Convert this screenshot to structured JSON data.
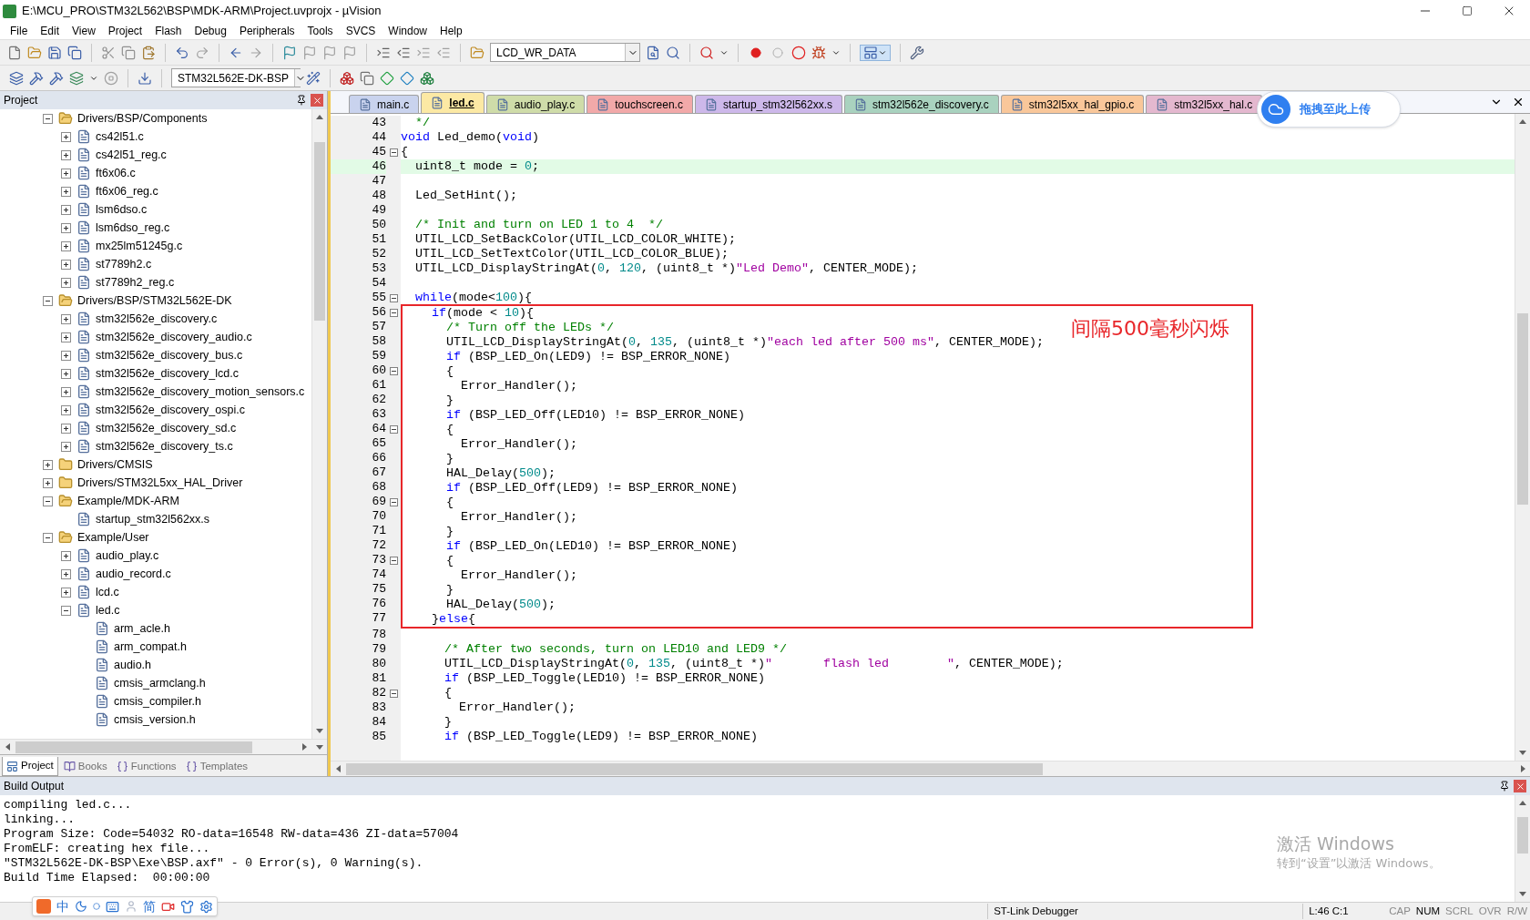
{
  "window": {
    "title": "E:\\MCU_PRO\\STM32L562\\BSP\\MDK-ARM\\Project.uvprojx - µVision"
  },
  "menu": [
    "File",
    "Edit",
    "View",
    "Project",
    "Flash",
    "Debug",
    "Peripherals",
    "Tools",
    "SVCS",
    "Window",
    "Help"
  ],
  "toolbar": {
    "find_combo": "LCD_WR_DATA",
    "target_combo": "STM32L562E-DK-BSP"
  },
  "project_panel": {
    "title": "Project",
    "tree": [
      {
        "label": "Drivers/BSP/Components",
        "kind": "folder",
        "expanded": true,
        "children": [
          {
            "label": "cs42l51.c",
            "kind": "source",
            "expanded": false
          },
          {
            "label": "cs42l51_reg.c",
            "kind": "source",
            "expanded": false
          },
          {
            "label": "ft6x06.c",
            "kind": "source",
            "expanded": false
          },
          {
            "label": "ft6x06_reg.c",
            "kind": "source",
            "expanded": false
          },
          {
            "label": "lsm6dso.c",
            "kind": "source",
            "expanded": false
          },
          {
            "label": "lsm6dso_reg.c",
            "kind": "source",
            "expanded": false
          },
          {
            "label": "mx25lm51245g.c",
            "kind": "source",
            "expanded": false
          },
          {
            "label": "st7789h2.c",
            "kind": "source",
            "expanded": false
          },
          {
            "label": "st7789h2_reg.c",
            "kind": "source",
            "expanded": false
          }
        ]
      },
      {
        "label": "Drivers/BSP/STM32L562E-DK",
        "kind": "folder",
        "expanded": true,
        "children": [
          {
            "label": "stm32l562e_discovery.c",
            "kind": "source",
            "expanded": false
          },
          {
            "label": "stm32l562e_discovery_audio.c",
            "kind": "source",
            "expanded": false
          },
          {
            "label": "stm32l562e_discovery_bus.c",
            "kind": "source",
            "expanded": false
          },
          {
            "label": "stm32l562e_discovery_lcd.c",
            "kind": "source",
            "expanded": false
          },
          {
            "label": "stm32l562e_discovery_motion_sensors.c",
            "kind": "source",
            "expanded": false
          },
          {
            "label": "stm32l562e_discovery_ospi.c",
            "kind": "source",
            "expanded": false
          },
          {
            "label": "stm32l562e_discovery_sd.c",
            "kind": "source",
            "expanded": false
          },
          {
            "label": "stm32l562e_discovery_ts.c",
            "kind": "source",
            "expanded": false
          }
        ]
      },
      {
        "label": "Drivers/CMSIS",
        "kind": "folder",
        "expanded": false
      },
      {
        "label": "Drivers/STM32L5xx_HAL_Driver",
        "kind": "folder",
        "expanded": false
      },
      {
        "label": "Example/MDK-ARM",
        "kind": "folder",
        "expanded": true,
        "children": [
          {
            "label": "startup_stm32l562xx.s",
            "kind": "file"
          }
        ]
      },
      {
        "label": "Example/User",
        "kind": "folder",
        "expanded": true,
        "children": [
          {
            "label": "audio_play.c",
            "kind": "source",
            "expanded": false
          },
          {
            "label": "audio_record.c",
            "kind": "source",
            "expanded": false
          },
          {
            "label": "lcd.c",
            "kind": "source",
            "expanded": false
          },
          {
            "label": "led.c",
            "kind": "source",
            "expanded": true,
            "children": [
              {
                "label": "arm_acle.h",
                "kind": "file"
              },
              {
                "label": "arm_compat.h",
                "kind": "file"
              },
              {
                "label": "audio.h",
                "kind": "file"
              },
              {
                "label": "cmsis_armclang.h",
                "kind": "file"
              },
              {
                "label": "cmsis_compiler.h",
                "kind": "file"
              },
              {
                "label": "cmsis_version.h",
                "kind": "file"
              }
            ]
          }
        ]
      }
    ],
    "tabs": [
      {
        "label": "Project",
        "selected": true
      },
      {
        "label": "Books",
        "selected": false
      },
      {
        "label": "Functions",
        "selected": false
      },
      {
        "label": "Templates",
        "selected": false
      }
    ]
  },
  "editor": {
    "tabs": [
      {
        "label": "main.c",
        "selected": false,
        "color": "#c9d3ee"
      },
      {
        "label": "led.c",
        "selected": true,
        "color": "#fce9a4"
      },
      {
        "label": "audio_play.c",
        "selected": false,
        "color": "#cfdca9"
      },
      {
        "label": "touchscreen.c",
        "selected": false,
        "color": "#f2a9a9"
      },
      {
        "label": "startup_stm32l562xx.s",
        "selected": false,
        "color": "#cdb8ea"
      },
      {
        "label": "stm32l562e_discovery.c",
        "selected": false,
        "color": "#a9d2bf"
      },
      {
        "label": "stm32l5xx_hal_gpio.c",
        "selected": false,
        "color": "#f9c79a"
      },
      {
        "label": "stm32l5xx_hal.c",
        "selected": false,
        "color": "#e4b8cf"
      }
    ],
    "blocks": [
      {
        "kind": "plain",
        "lines": [
          {
            "number": "43",
            "fold": false,
            "current": false,
            "tokens": [
              {
                "kind": "comment",
                "text": "  */"
              }
            ]
          },
          {
            "number": "44",
            "fold": false,
            "current": false,
            "tokens": [
              {
                "kind": "keyword",
                "text": "void"
              },
              {
                "kind": "plain",
                "text": " Led_demo("
              },
              {
                "kind": "keyword",
                "text": "void"
              },
              {
                "kind": "plain",
                "text": ")"
              }
            ]
          },
          {
            "number": "45",
            "fold": true,
            "current": false,
            "tokens": [
              {
                "kind": "plain",
                "text": "{"
              }
            ]
          },
          {
            "number": "46",
            "fold": false,
            "current": true,
            "tokens": [
              {
                "kind": "plain",
                "text": "  uint8_t mode = "
              },
              {
                "kind": "number",
                "text": "0"
              },
              {
                "kind": "plain",
                "text": ";"
              }
            ]
          },
          {
            "number": "47",
            "fold": false,
            "current": false
          },
          {
            "number": "48",
            "fold": false,
            "current": false,
            "tokens": [
              {
                "kind": "plain",
                "text": "  Led_SetHint();"
              }
            ]
          },
          {
            "number": "49",
            "fold": false,
            "current": false
          },
          {
            "number": "50",
            "fold": false,
            "current": false,
            "tokens": [
              {
                "kind": "comment",
                "text": "  /* Init and turn on LED 1 to 4  */"
              }
            ]
          },
          {
            "number": "51",
            "fold": false,
            "current": false,
            "tokens": [
              {
                "kind": "plain",
                "text": "  UTIL_LCD_SetBackColor(UTIL_LCD_COLOR_WHITE);"
              }
            ]
          },
          {
            "number": "52",
            "fold": false,
            "current": false,
            "tokens": [
              {
                "kind": "plain",
                "text": "  UTIL_LCD_SetTextColor(UTIL_LCD_COLOR_BLUE);"
              }
            ]
          },
          {
            "number": "53",
            "fold": false,
            "current": false,
            "tokens": [
              {
                "kind": "plain",
                "text": "  UTIL_LCD_DisplayStringAt("
              },
              {
                "kind": "number",
                "text": "0"
              },
              {
                "kind": "plain",
                "text": ", "
              },
              {
                "kind": "number",
                "text": "120"
              },
              {
                "kind": "plain",
                "text": ", (uint8_t *)"
              },
              {
                "kind": "string",
                "text": "\"Led Demo\""
              },
              {
                "kind": "plain",
                "text": ", CENTER_MODE);"
              }
            ]
          },
          {
            "number": "54",
            "fold": false,
            "current": false
          },
          {
            "number": "55",
            "fold": true,
            "current": false,
            "tokens": [
              {
                "kind": "keyword",
                "text": "  while"
              },
              {
                "kind": "plain",
                "text": "(mode<"
              },
              {
                "kind": "number",
                "text": "100"
              },
              {
                "kind": "plain",
                "text": "){"
              }
            ]
          }
        ]
      },
      {
        "kind": "highlight_box",
        "note": "间隔500毫秒闪烁",
        "lines": [
          {
            "number": "56",
            "fold": true,
            "current": false,
            "tokens": [
              {
                "kind": "keyword",
                "text": "    if"
              },
              {
                "kind": "plain",
                "text": "(mode < "
              },
              {
                "kind": "number",
                "text": "10"
              },
              {
                "kind": "plain",
                "text": "){"
              }
            ]
          },
          {
            "number": "57",
            "fold": false,
            "current": false,
            "tokens": [
              {
                "kind": "comment",
                "text": "      /* Turn off the LEDs */"
              }
            ]
          },
          {
            "number": "58",
            "fold": false,
            "current": false,
            "tokens": [
              {
                "kind": "plain",
                "text": "      UTIL_LCD_DisplayStringAt("
              },
              {
                "kind": "number",
                "text": "0"
              },
              {
                "kind": "plain",
                "text": ", "
              },
              {
                "kind": "number",
                "text": "135"
              },
              {
                "kind": "plain",
                "text": ", (uint8_t *)"
              },
              {
                "kind": "string",
                "text": "\"each led after 500 ms\""
              },
              {
                "kind": "plain",
                "text": ", CENTER_MODE);"
              }
            ]
          },
          {
            "number": "59",
            "fold": false,
            "current": false,
            "tokens": [
              {
                "kind": "keyword",
                "text": "      if"
              },
              {
                "kind": "plain",
                "text": " (BSP_LED_On(LED9) != BSP_ERROR_NONE)"
              }
            ]
          },
          {
            "number": "60",
            "fold": true,
            "current": false,
            "tokens": [
              {
                "kind": "plain",
                "text": "      {"
              }
            ]
          },
          {
            "number": "61",
            "fold": false,
            "current": false,
            "tokens": [
              {
                "kind": "plain",
                "text": "        Error_Handler();"
              }
            ]
          },
          {
            "number": "62",
            "fold": false,
            "current": false,
            "tokens": [
              {
                "kind": "plain",
                "text": "      }"
              }
            ]
          },
          {
            "number": "63",
            "fold": false,
            "current": false,
            "tokens": [
              {
                "kind": "keyword",
                "text": "      if"
              },
              {
                "kind": "plain",
                "text": " (BSP_LED_Off(LED10) != BSP_ERROR_NONE)"
              }
            ]
          },
          {
            "number": "64",
            "fold": true,
            "current": false,
            "tokens": [
              {
                "kind": "plain",
                "text": "      {"
              }
            ]
          },
          {
            "number": "65",
            "fold": false,
            "current": false,
            "tokens": [
              {
                "kind": "plain",
                "text": "        Error_Handler();"
              }
            ]
          },
          {
            "number": "66",
            "fold": false,
            "current": false,
            "tokens": [
              {
                "kind": "plain",
                "text": "      }"
              }
            ]
          },
          {
            "number": "67",
            "fold": false,
            "current": false,
            "tokens": [
              {
                "kind": "plain",
                "text": "      HAL_Delay("
              },
              {
                "kind": "number",
                "text": "500"
              },
              {
                "kind": "plain",
                "text": ");"
              }
            ]
          },
          {
            "number": "68",
            "fold": false,
            "current": false,
            "tokens": [
              {
                "kind": "keyword",
                "text": "      if"
              },
              {
                "kind": "plain",
                "text": " (BSP_LED_Off(LED9) != BSP_ERROR_NONE)"
              }
            ]
          },
          {
            "number": "69",
            "fold": true,
            "current": false,
            "tokens": [
              {
                "kind": "plain",
                "text": "      {"
              }
            ]
          },
          {
            "number": "70",
            "fold": false,
            "current": false,
            "tokens": [
              {
                "kind": "plain",
                "text": "        Error_Handler();"
              }
            ]
          },
          {
            "number": "71",
            "fold": false,
            "current": false,
            "tokens": [
              {
                "kind": "plain",
                "text": "      }"
              }
            ]
          },
          {
            "number": "72",
            "fold": false,
            "current": false,
            "tokens": [
              {
                "kind": "keyword",
                "text": "      if"
              },
              {
                "kind": "plain",
                "text": " (BSP_LED_On(LED10) != BSP_ERROR_NONE)"
              }
            ]
          },
          {
            "number": "73",
            "fold": true,
            "current": false,
            "tokens": [
              {
                "kind": "plain",
                "text": "      {"
              }
            ]
          },
          {
            "number": "74",
            "fold": false,
            "current": false,
            "tokens": [
              {
                "kind": "plain",
                "text": "        Error_Handler();"
              }
            ]
          },
          {
            "number": "75",
            "fold": false,
            "current": false,
            "tokens": [
              {
                "kind": "plain",
                "text": "      }"
              }
            ]
          },
          {
            "number": "76",
            "fold": false,
            "current": false,
            "tokens": [
              {
                "kind": "plain",
                "text": "      HAL_Delay("
              },
              {
                "kind": "number",
                "text": "500"
              },
              {
                "kind": "plain",
                "text": ");"
              }
            ]
          },
          {
            "number": "77",
            "fold": false,
            "current": false,
            "tokens": [
              {
                "kind": "plain",
                "text": "    }"
              },
              {
                "kind": "keyword",
                "text": "else"
              },
              {
                "kind": "plain",
                "text": "{"
              }
            ]
          }
        ]
      },
      {
        "kind": "plain",
        "lines": [
          {
            "number": "78",
            "fold": false,
            "current": false
          },
          {
            "number": "79",
            "fold": false,
            "current": false,
            "tokens": [
              {
                "kind": "comment",
                "text": "      /* After two seconds, turn on LED10 and LED9 */"
              }
            ]
          },
          {
            "number": "80",
            "fold": false,
            "current": false,
            "tokens": [
              {
                "kind": "plain",
                "text": "      UTIL_LCD_DisplayStringAt("
              },
              {
                "kind": "number",
                "text": "0"
              },
              {
                "kind": "plain",
                "text": ", "
              },
              {
                "kind": "number",
                "text": "135"
              },
              {
                "kind": "plain",
                "text": ", (uint8_t *)"
              },
              {
                "kind": "string",
                "text": "\"       flash led        \""
              },
              {
                "kind": "plain",
                "text": ", CENTER_MODE);"
              }
            ]
          },
          {
            "number": "81",
            "fold": false,
            "current": false,
            "tokens": [
              {
                "kind": "keyword",
                "text": "      if"
              },
              {
                "kind": "plain",
                "text": " (BSP_LED_Toggle(LED10) != BSP_ERROR_NONE)"
              }
            ]
          },
          {
            "number": "82",
            "fold": true,
            "current": false,
            "tokens": [
              {
                "kind": "plain",
                "text": "      {"
              }
            ]
          },
          {
            "number": "83",
            "fold": false,
            "current": false,
            "tokens": [
              {
                "kind": "plain",
                "text": "        Error_Handler();"
              }
            ]
          },
          {
            "number": "84",
            "fold": false,
            "current": false,
            "tokens": [
              {
                "kind": "plain",
                "text": "      }"
              }
            ]
          },
          {
            "number": "85",
            "fold": false,
            "current": false,
            "tokens": [
              {
                "kind": "keyword",
                "text": "      if"
              },
              {
                "kind": "plain",
                "text": " (BSP_LED_Toggle(LED9) != BSP_ERROR_NONE)"
              }
            ]
          }
        ]
      }
    ]
  },
  "upload_widget": {
    "label": "拖拽至此上传"
  },
  "build_output": {
    "title": "Build Output",
    "lines": [
      "compiling led.c...",
      "linking...",
      "Program Size: Code=54032 RO-data=16548 RW-data=436 ZI-data=57004",
      "FromELF: creating hex file...",
      "\"STM32L562E-DK-BSP\\Exe\\BSP.axf\" - 0 Error(s), 0 Warning(s).",
      "Build Time Elapsed:  00:00:00"
    ]
  },
  "activation_notice": {
    "title": "激活 Windows",
    "subtitle": "转到“设置”以激活 Windows。"
  },
  "ime_toolbar": {
    "language": "中",
    "script": "简"
  },
  "status_bar": {
    "debugger": "ST-Link Debugger",
    "position": "L:46 C:1",
    "indicators": [
      {
        "label": "CAP",
        "on": false
      },
      {
        "label": "NUM",
        "on": true
      },
      {
        "label": "SCRL",
        "on": false
      },
      {
        "label": "OVR",
        "on": false
      },
      {
        "label": "R/W",
        "on": false
      }
    ]
  }
}
